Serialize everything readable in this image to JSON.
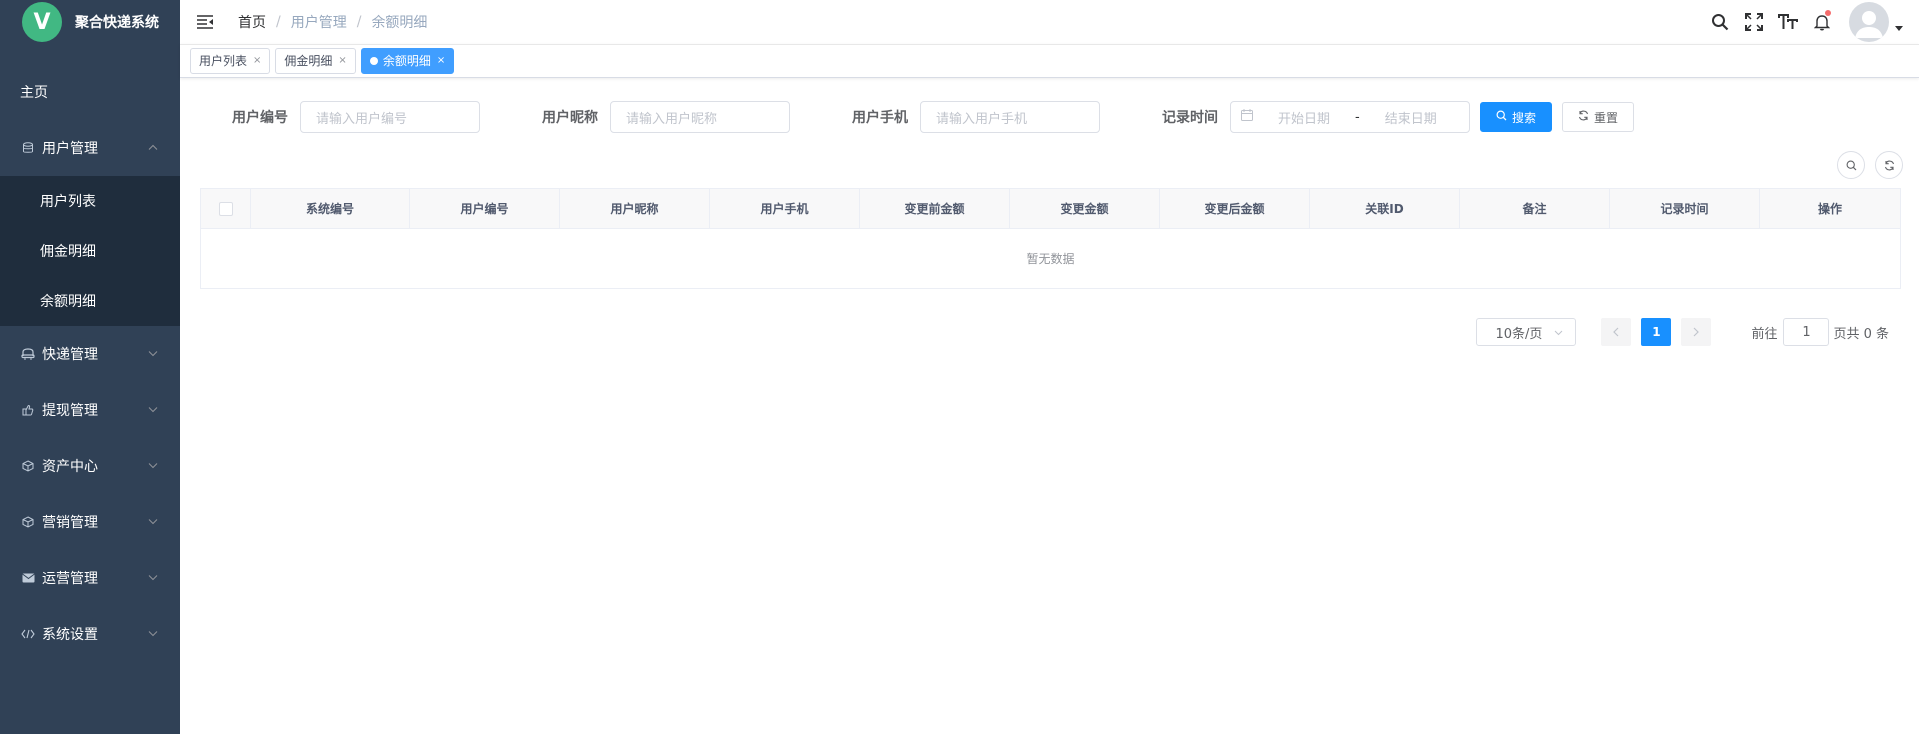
{
  "app": {
    "logo_letter": "V",
    "title": "聚合快递系统"
  },
  "sidebar": {
    "home": "主页",
    "groups": [
      {
        "label": "用户管理",
        "icon": "database-icon",
        "expanded": true,
        "items": [
          {
            "label": "用户列表"
          },
          {
            "label": "佣金明细"
          },
          {
            "label": "余额明细"
          }
        ]
      },
      {
        "label": "快递管理",
        "icon": "truck-icon"
      },
      {
        "label": "提现管理",
        "icon": "hand-icon"
      },
      {
        "label": "资产中心",
        "icon": "box-icon"
      },
      {
        "label": "营销管理",
        "icon": "box-icon"
      },
      {
        "label": "运营管理",
        "icon": "mail-icon"
      },
      {
        "label": "系统设置",
        "icon": "code-icon"
      }
    ]
  },
  "breadcrumb": {
    "items": [
      "首页",
      "用户管理",
      "余额明细"
    ],
    "separator": "/"
  },
  "tags": {
    "items": [
      {
        "label": "用户列表"
      },
      {
        "label": "佣金明细"
      },
      {
        "label": "余额明细",
        "active": true
      }
    ],
    "close": "×"
  },
  "search": {
    "fields": [
      {
        "label": "用户编号",
        "placeholder": "请输入用户编号"
      },
      {
        "label": "用户昵称",
        "placeholder": "请输入用户昵称"
      },
      {
        "label": "用户手机",
        "placeholder": "请输入用户手机"
      }
    ],
    "date": {
      "label": "记录时间",
      "start_placeholder": "开始日期",
      "separator": "-",
      "end_placeholder": "结束日期"
    },
    "search_button": "搜索",
    "reset_button": "重置"
  },
  "table": {
    "columns": [
      "系统编号",
      "用户编号",
      "用户昵称",
      "用户手机",
      "变更前金额",
      "变更金额",
      "变更后金额",
      "关联ID",
      "备注",
      "记录时间",
      "操作"
    ],
    "empty_text": "暂无数据"
  },
  "pagination": {
    "page_size": "10条/页",
    "current_page": "1",
    "goto_label": "前往",
    "goto_value": "1",
    "total_text": "页共 0 条"
  },
  "colors": {
    "sidebar_bg": "#304156",
    "submenu_bg": "#1f2d3d",
    "submenu_active_bg": "#001528",
    "primary": "#1890ff",
    "logo": "#41b883"
  }
}
